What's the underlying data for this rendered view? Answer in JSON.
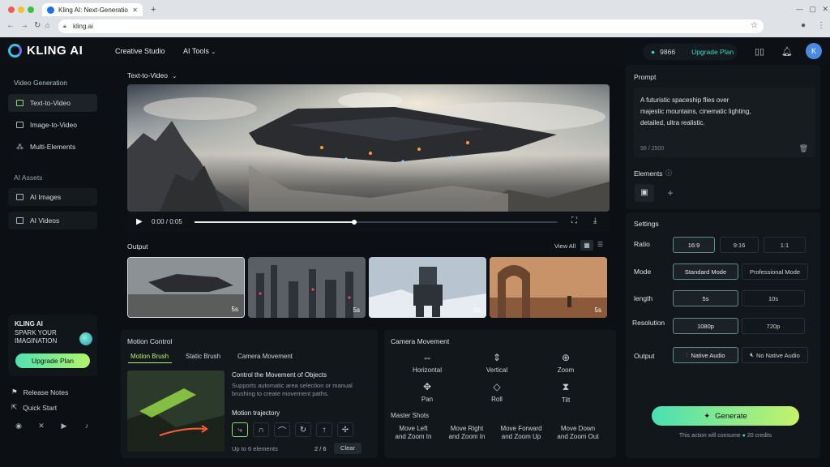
{
  "browser": {
    "tab_title": "Kling AI: Next-Generation AI C",
    "address": "kling.ai"
  },
  "app": {
    "logo_text": "KLING AI",
    "nav": [
      "Creative Studio",
      "AI Tools"
    ],
    "credits": "9866",
    "upgrade_label": "Upgrade Plan",
    "avatar_initial": "K"
  },
  "sidebar": {
    "video_heading": "Video Generation",
    "video_items": [
      "Text-to-Video",
      "Image-to-Video",
      "Multi-Elements"
    ],
    "assets_heading": "AI Assets",
    "asset_items": [
      "AI Images",
      "AI Videos"
    ],
    "promo_brand": "KLING AI",
    "promo_line1": "SPARK YOUR",
    "promo_line2": "IMAGINATION",
    "promo_button": "Upgrade Plan",
    "links": [
      "Release Notes",
      "Quick Start"
    ],
    "social_icons": [
      "discord-icon",
      "x-icon",
      "youtube-icon",
      "tiktok-icon"
    ]
  },
  "main": {
    "mode_label": "Text-to-Video",
    "time": "0:00 / 0:05",
    "progress": 0.44,
    "output_label": "Output",
    "view_all": "View All",
    "thumbs": [
      {
        "dur": "5s"
      },
      {
        "dur": "5s"
      },
      {
        "dur": "5s"
      },
      {
        "dur": "5s"
      }
    ]
  },
  "motion": {
    "title": "Motion Control",
    "tabs": [
      "Motion Brush",
      "Static Brush",
      "Camera Movement"
    ],
    "heading": "Control the Movement of Objects",
    "desc": "Supports automatic area selection or manual brushing to create movement paths.",
    "traj_label": "Motion trajectory",
    "footer_left": "Up to 6 elements",
    "count": "2 / 6",
    "clear": "Clear"
  },
  "camera": {
    "title": "Camera Movement",
    "items": [
      "Horizontal",
      "Vertical",
      "Zoom",
      "Pan",
      "Roll",
      "Tilt"
    ],
    "master_label": "Master Shots",
    "shots": [
      [
        "Move Left",
        "and Zoom In"
      ],
      [
        "Move Right",
        "and Zoom In"
      ],
      [
        "Move Forward",
        "and Zoom Up"
      ],
      [
        "Move Down",
        "and Zoom Out"
      ]
    ]
  },
  "right": {
    "prompt_label": "Prompt",
    "prompt_lines": [
      "A futuristic spaceship flies over",
      "majestic mountains, cinematic lighting,",
      "detailed, ultra realistic."
    ],
    "char_count": "98 / 2500",
    "elements_label": "Elements",
    "settings_label": "Settings",
    "ratio_label": "Ratio",
    "ratios": [
      "16:9",
      "9:16",
      "1:1"
    ],
    "mode_label": "Mode",
    "modes": [
      "Standard Mode",
      "Professional Mode"
    ],
    "length_label": "length",
    "lengths": [
      "5s",
      "10s"
    ],
    "res_label": "Resolution",
    "resolutions": [
      "1080p",
      "720p"
    ],
    "output_label": "Output",
    "outputs": [
      "Native Audio",
      "No Native Audio"
    ],
    "generate": "Generate",
    "consume_note": "This action will consume",
    "consume_credits": "20 credits"
  },
  "colors": {
    "accent": "#4fe3b0",
    "accent_lime": "#b9f06a",
    "bg": "#0c0f13"
  }
}
